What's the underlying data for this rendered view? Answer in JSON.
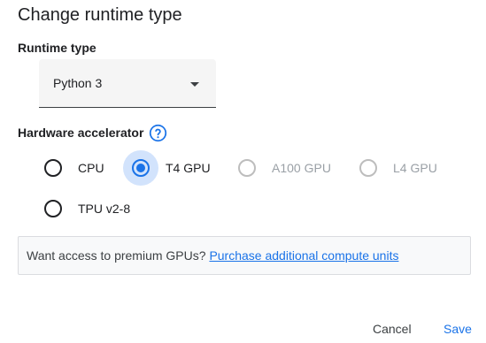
{
  "dialog": {
    "title": "Change runtime type"
  },
  "runtime": {
    "label": "Runtime type",
    "selected": "Python 3"
  },
  "hardware": {
    "label": "Hardware accelerator",
    "options": [
      {
        "label": "CPU",
        "selected": false,
        "disabled": false
      },
      {
        "label": "T4 GPU",
        "selected": true,
        "disabled": false
      },
      {
        "label": "A100 GPU",
        "selected": false,
        "disabled": true
      },
      {
        "label": "L4 GPU",
        "selected": false,
        "disabled": true
      },
      {
        "label": "TPU v2-8",
        "selected": false,
        "disabled": false
      }
    ]
  },
  "info": {
    "text": "Want access to premium GPUs?",
    "link": "Purchase additional compute units"
  },
  "actions": {
    "cancel": "Cancel",
    "save": "Save"
  },
  "colors": {
    "accent": "#1a73e8",
    "selected_halo": "#d2e3fc",
    "disabled": "#9aa0a6"
  }
}
